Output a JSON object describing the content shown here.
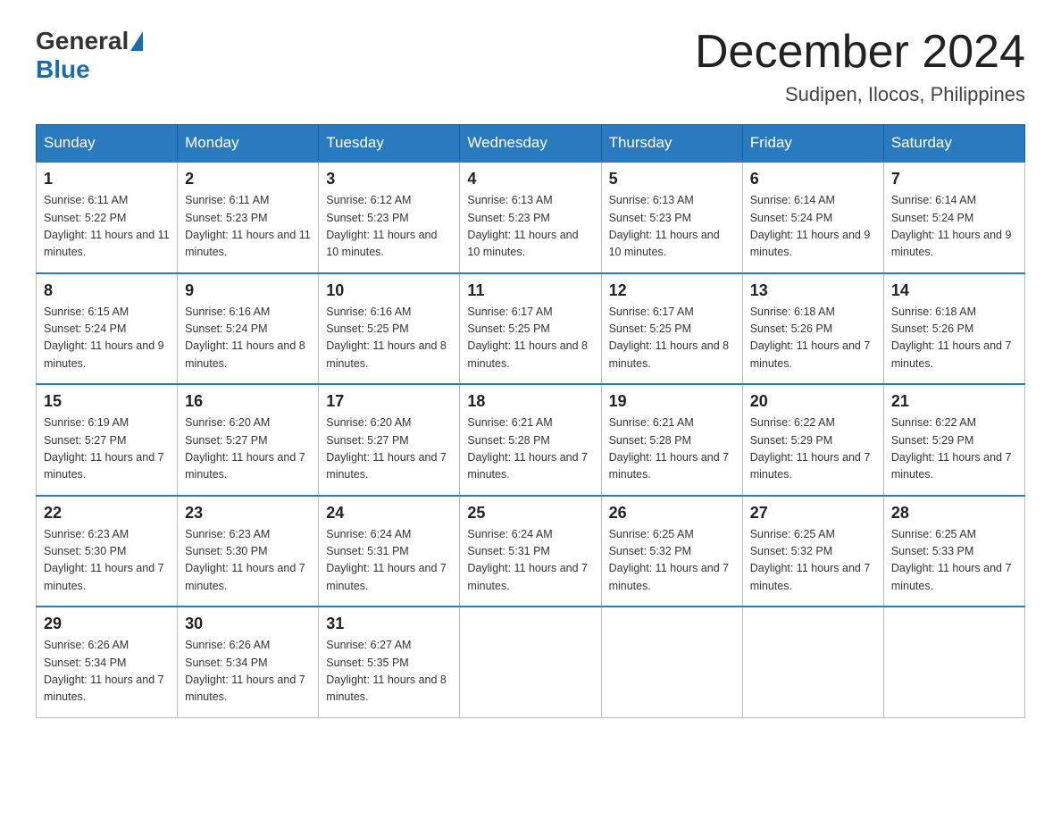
{
  "header": {
    "logo_general": "General",
    "logo_blue": "Blue",
    "month_year": "December 2024",
    "location": "Sudipen, Ilocos, Philippines"
  },
  "days_of_week": [
    "Sunday",
    "Monday",
    "Tuesday",
    "Wednesday",
    "Thursday",
    "Friday",
    "Saturday"
  ],
  "weeks": [
    [
      {
        "day": "1",
        "sunrise": "6:11 AM",
        "sunset": "5:22 PM",
        "daylight": "11 hours and 11 minutes."
      },
      {
        "day": "2",
        "sunrise": "6:11 AM",
        "sunset": "5:23 PM",
        "daylight": "11 hours and 11 minutes."
      },
      {
        "day": "3",
        "sunrise": "6:12 AM",
        "sunset": "5:23 PM",
        "daylight": "11 hours and 10 minutes."
      },
      {
        "day": "4",
        "sunrise": "6:13 AM",
        "sunset": "5:23 PM",
        "daylight": "11 hours and 10 minutes."
      },
      {
        "day": "5",
        "sunrise": "6:13 AM",
        "sunset": "5:23 PM",
        "daylight": "11 hours and 10 minutes."
      },
      {
        "day": "6",
        "sunrise": "6:14 AM",
        "sunset": "5:24 PM",
        "daylight": "11 hours and 9 minutes."
      },
      {
        "day": "7",
        "sunrise": "6:14 AM",
        "sunset": "5:24 PM",
        "daylight": "11 hours and 9 minutes."
      }
    ],
    [
      {
        "day": "8",
        "sunrise": "6:15 AM",
        "sunset": "5:24 PM",
        "daylight": "11 hours and 9 minutes."
      },
      {
        "day": "9",
        "sunrise": "6:16 AM",
        "sunset": "5:24 PM",
        "daylight": "11 hours and 8 minutes."
      },
      {
        "day": "10",
        "sunrise": "6:16 AM",
        "sunset": "5:25 PM",
        "daylight": "11 hours and 8 minutes."
      },
      {
        "day": "11",
        "sunrise": "6:17 AM",
        "sunset": "5:25 PM",
        "daylight": "11 hours and 8 minutes."
      },
      {
        "day": "12",
        "sunrise": "6:17 AM",
        "sunset": "5:25 PM",
        "daylight": "11 hours and 8 minutes."
      },
      {
        "day": "13",
        "sunrise": "6:18 AM",
        "sunset": "5:26 PM",
        "daylight": "11 hours and 7 minutes."
      },
      {
        "day": "14",
        "sunrise": "6:18 AM",
        "sunset": "5:26 PM",
        "daylight": "11 hours and 7 minutes."
      }
    ],
    [
      {
        "day": "15",
        "sunrise": "6:19 AM",
        "sunset": "5:27 PM",
        "daylight": "11 hours and 7 minutes."
      },
      {
        "day": "16",
        "sunrise": "6:20 AM",
        "sunset": "5:27 PM",
        "daylight": "11 hours and 7 minutes."
      },
      {
        "day": "17",
        "sunrise": "6:20 AM",
        "sunset": "5:27 PM",
        "daylight": "11 hours and 7 minutes."
      },
      {
        "day": "18",
        "sunrise": "6:21 AM",
        "sunset": "5:28 PM",
        "daylight": "11 hours and 7 minutes."
      },
      {
        "day": "19",
        "sunrise": "6:21 AM",
        "sunset": "5:28 PM",
        "daylight": "11 hours and 7 minutes."
      },
      {
        "day": "20",
        "sunrise": "6:22 AM",
        "sunset": "5:29 PM",
        "daylight": "11 hours and 7 minutes."
      },
      {
        "day": "21",
        "sunrise": "6:22 AM",
        "sunset": "5:29 PM",
        "daylight": "11 hours and 7 minutes."
      }
    ],
    [
      {
        "day": "22",
        "sunrise": "6:23 AM",
        "sunset": "5:30 PM",
        "daylight": "11 hours and 7 minutes."
      },
      {
        "day": "23",
        "sunrise": "6:23 AM",
        "sunset": "5:30 PM",
        "daylight": "11 hours and 7 minutes."
      },
      {
        "day": "24",
        "sunrise": "6:24 AM",
        "sunset": "5:31 PM",
        "daylight": "11 hours and 7 minutes."
      },
      {
        "day": "25",
        "sunrise": "6:24 AM",
        "sunset": "5:31 PM",
        "daylight": "11 hours and 7 minutes."
      },
      {
        "day": "26",
        "sunrise": "6:25 AM",
        "sunset": "5:32 PM",
        "daylight": "11 hours and 7 minutes."
      },
      {
        "day": "27",
        "sunrise": "6:25 AM",
        "sunset": "5:32 PM",
        "daylight": "11 hours and 7 minutes."
      },
      {
        "day": "28",
        "sunrise": "6:25 AM",
        "sunset": "5:33 PM",
        "daylight": "11 hours and 7 minutes."
      }
    ],
    [
      {
        "day": "29",
        "sunrise": "6:26 AM",
        "sunset": "5:34 PM",
        "daylight": "11 hours and 7 minutes."
      },
      {
        "day": "30",
        "sunrise": "6:26 AM",
        "sunset": "5:34 PM",
        "daylight": "11 hours and 7 minutes."
      },
      {
        "day": "31",
        "sunrise": "6:27 AM",
        "sunset": "5:35 PM",
        "daylight": "11 hours and 8 minutes."
      },
      null,
      null,
      null,
      null
    ]
  ]
}
